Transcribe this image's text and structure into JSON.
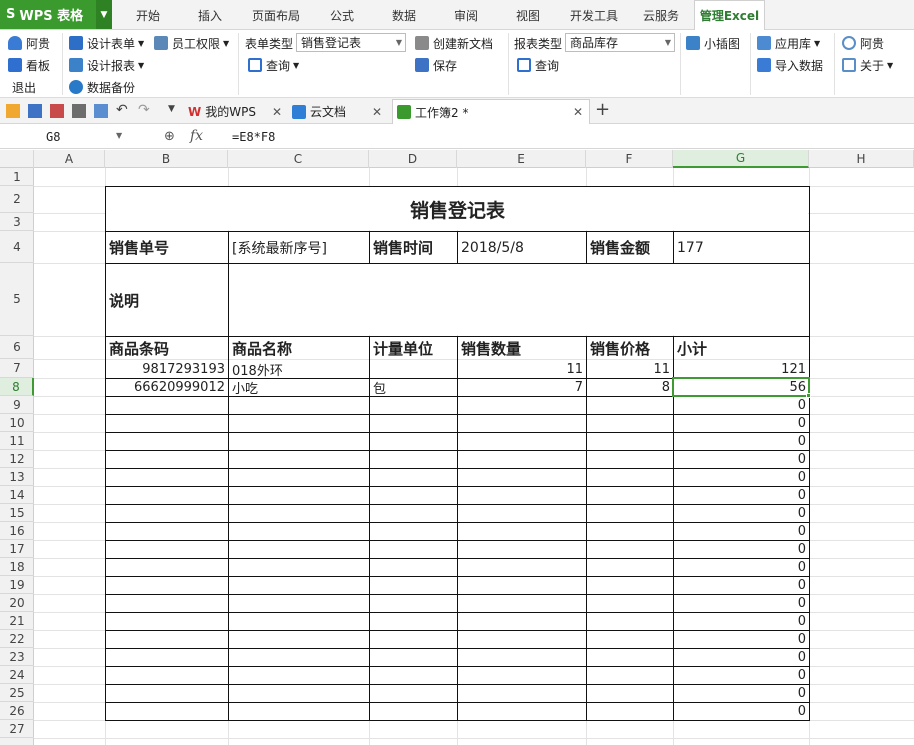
{
  "app": {
    "name": "WPS 表格"
  },
  "menu_tabs": [
    "开始",
    "插入",
    "页面布局",
    "公式",
    "数据",
    "审阅",
    "视图",
    "开发工具",
    "云服务",
    "管理Excel"
  ],
  "ribbon": {
    "user": "阿贵",
    "board": "看板",
    "exit": "退出",
    "design_form": "设计表单",
    "design_report": "设计报表",
    "backup": "数据备份",
    "staff_perm": "员工权限",
    "form_type_label": "表单类型",
    "form_type_value": "销售登记表",
    "form_query": "查询",
    "create_doc": "创建新文档",
    "save": "保存",
    "report_type_label": "报表类型",
    "report_type_value": "商品库存",
    "report_query": "查询",
    "mini_chart": "小插图",
    "app_store": "应用库",
    "import_data": "导入数据",
    "account": "阿贵",
    "about": "关于"
  },
  "doc_tabs": [
    {
      "label": "我的WPS"
    },
    {
      "label": "云文档"
    },
    {
      "label": "工作簿2 *"
    }
  ],
  "formula_bar": {
    "cell_ref": "G8",
    "fx": "fx",
    "formula": "=E8*F8"
  },
  "columns": [
    "A",
    "B",
    "C",
    "D",
    "E",
    "F",
    "G",
    "H"
  ],
  "rows": [
    "1",
    "2",
    "3",
    "4",
    "5",
    "6",
    "7",
    "8",
    "9",
    "10",
    "11",
    "12",
    "13",
    "14",
    "15",
    "16",
    "17",
    "18",
    "19",
    "20",
    "21",
    "22",
    "23",
    "24",
    "25",
    "26",
    "27"
  ],
  "form": {
    "title": "销售登记表",
    "labels": {
      "order_no": "销售单号",
      "time": "销售时间",
      "amount": "销售金额",
      "note": "说明"
    },
    "values": {
      "order_no": "[系统最新序号]",
      "time": "2018/5/8",
      "amount": "177"
    },
    "table_headers": [
      "商品条码",
      "商品名称",
      "计量单位",
      "销售数量",
      "销售价格",
      "小计"
    ],
    "items": [
      {
        "barcode": "9817293193",
        "name": "018外环",
        "unit": "",
        "qty": "11",
        "price": "11",
        "subtotal": "121"
      },
      {
        "barcode": "66620999012",
        "name": "小吃",
        "unit": "包",
        "qty": "7",
        "price": "8",
        "subtotal": "56"
      }
    ],
    "empty_subtotal": "0"
  }
}
